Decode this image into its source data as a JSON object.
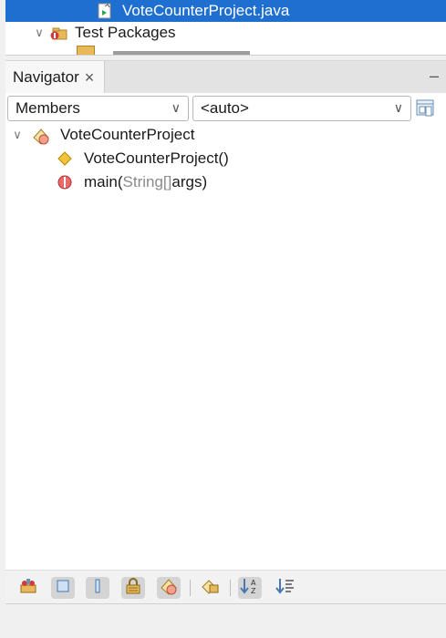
{
  "projects": {
    "selected_file": "VoteCounterProject.java",
    "test_packages": "Test Packages"
  },
  "navigator": {
    "tab_label": "Navigator",
    "close_glyph": "×",
    "minimize_glyph": "–",
    "members_combo": "Members",
    "auto_combo": "<auto>",
    "combo_arrow": "∨",
    "tree": {
      "root": {
        "label": "VoteCounterProject",
        "chevron": "∨",
        "icon": "class-icon"
      },
      "items": [
        {
          "label": "VoteCounterProject()",
          "icon": "constructor-icon"
        },
        {
          "method": "main(",
          "type": "String[]",
          "rest": " args)",
          "icon": "static-method-icon"
        }
      ]
    }
  },
  "toolbar": {
    "buttons": [
      {
        "name": "show-inherited-members",
        "icon": "inherited-icon",
        "on": false
      },
      {
        "name": "show-fields",
        "icon": "fields-icon",
        "on": true
      },
      {
        "name": "show-static-members",
        "icon": "static-icon",
        "on": true
      },
      {
        "name": "show-non-public-members",
        "icon": "lock-icon",
        "on": true
      },
      {
        "name": "show-inner-classes",
        "icon": "inner-class-icon",
        "on": true
      },
      {
        "name": "show-fqn",
        "icon": "fqn-icon",
        "on": false
      },
      {
        "name": "sort-by-name",
        "icon": "sort-alpha-icon",
        "on": true
      },
      {
        "name": "sort-by-source",
        "icon": "sort-source-icon",
        "on": false
      }
    ]
  },
  "colors": {
    "selection": "#1f6fd0",
    "constructor": "#e8b000",
    "method": "#d43a3a"
  }
}
